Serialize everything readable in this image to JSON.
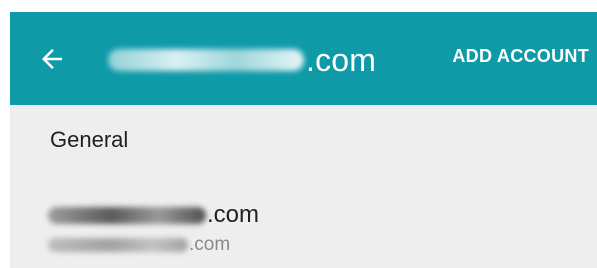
{
  "app_bar": {
    "back_icon": "arrow-left-icon",
    "account_suffix": ".com",
    "action_label": "ADD ACCOUNT",
    "background_color": "#0f9aa8"
  },
  "content": {
    "section_label": "General",
    "account": {
      "primary_suffix": ".com",
      "secondary_suffix": ".com"
    }
  }
}
